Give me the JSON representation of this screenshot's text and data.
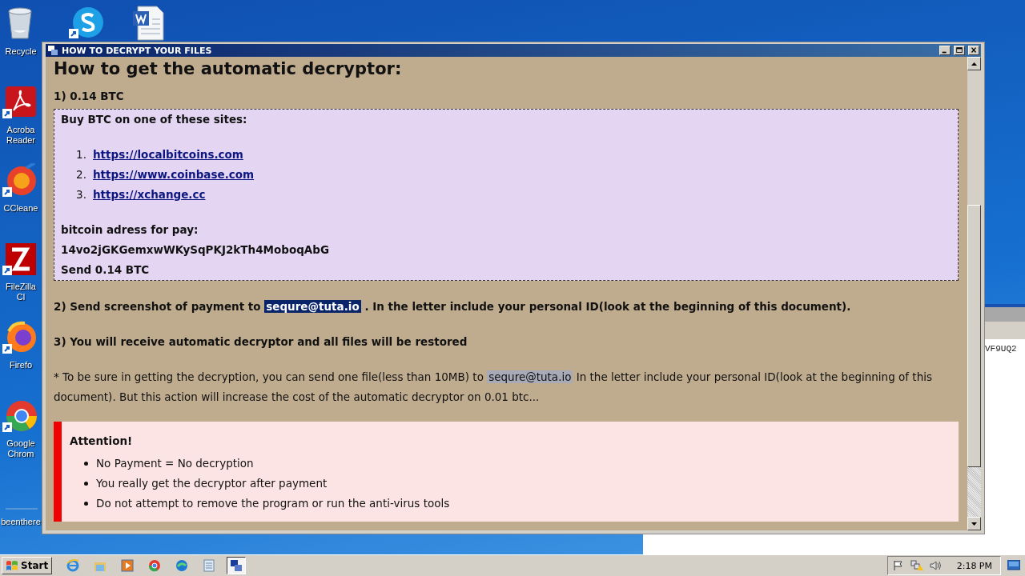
{
  "desktop_icons": [
    {
      "label": "Recycle",
      "kind": "recycle"
    },
    {
      "label": "Acroba Reader",
      "kind": "acrobat"
    },
    {
      "label": "CCleane",
      "kind": "ccleaner"
    },
    {
      "label": "FileZilla Cl",
      "kind": "filezilla"
    },
    {
      "label": "Firefo",
      "kind": "firefox"
    },
    {
      "label": "Google Chrom",
      "kind": "chrome"
    },
    {
      "label": "beenthere",
      "kind": "blank"
    }
  ],
  "desktop_top_icons": [
    {
      "kind": "skype"
    },
    {
      "kind": "word"
    }
  ],
  "background_window": {
    "text": "VF9UQ2"
  },
  "window": {
    "title": "HOW TO DECRYPT YOUR FILES",
    "heading": "How to get the automatic decryptor:",
    "step_1": "1) 0.14 BTC",
    "buy_box": {
      "title": "Buy BTC on one of these sites:",
      "links": [
        {
          "number": "1.",
          "url": "https://localbitcoins.com"
        },
        {
          "number": "2.",
          "url": "https://www.coinbase.com"
        },
        {
          "number": "3.",
          "url": "https://xchange.cc"
        }
      ],
      "address_label": "bitcoin adress for pay:",
      "address": "14vo2jGKGemxwWKySqPKJ2kTh4MoboqAbG",
      "send": "Send 0.14 BTC"
    },
    "step_2": {
      "before": "2) Send screenshot of payment to",
      "email": {
        "text": "sequre@tuta.io",
        "color": "#0a246a"
      },
      "after": ". In the letter include your personal ID(look at the beginning of this document)."
    },
    "step_3": "3) You will receive automatic decryptor and all files will be restored",
    "note": {
      "before": "* To be sure in getting the decryption, you can send one file(less than 10MB) to",
      "email": {
        "text": "sequre@tuta.io",
        "color": "#a9aab8"
      },
      "after": "In the letter include your personal ID(look at the beginning of this document). But this action will increase the cost of the automatic decryptor on 0.01 btc..."
    },
    "attention": {
      "title": "Attention!",
      "items": [
        "No Payment = No decryption",
        "You really get the decryptor after payment",
        "Do not attempt to remove the program or run the anti-virus tools"
      ]
    }
  },
  "taskbar": {
    "start": "Start",
    "apps": [
      {
        "kind": "ie",
        "selected": false
      },
      {
        "kind": "explorer",
        "selected": false
      },
      {
        "kind": "media",
        "selected": false
      },
      {
        "kind": "chrome",
        "selected": false
      },
      {
        "kind": "edge",
        "selected": false
      },
      {
        "kind": "notepad",
        "selected": false
      },
      {
        "kind": "ransom",
        "selected": true
      }
    ],
    "clock": "2:18 PM"
  }
}
